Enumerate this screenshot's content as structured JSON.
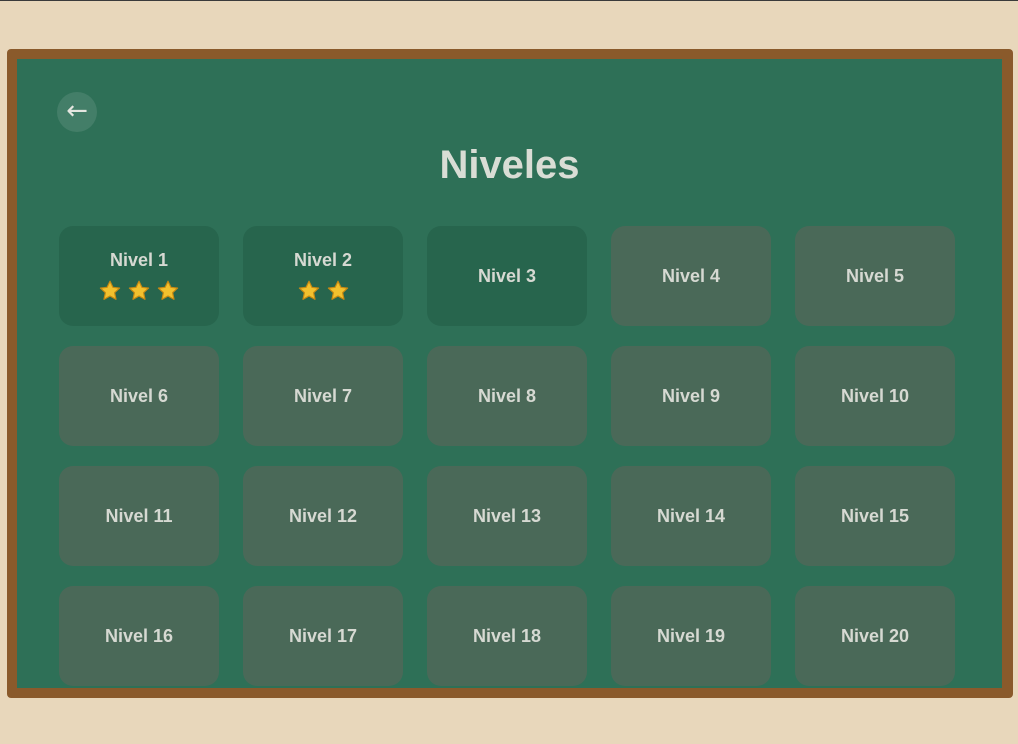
{
  "header": {
    "back_icon": "←",
    "title": "Niveles"
  },
  "colors": {
    "page_background": "#e8d7bb",
    "board_frame": "#8a5a2b",
    "board_surface": "#2e7057",
    "level_unlocked": "#27654d",
    "level_locked": "#4a6958",
    "star": "#f2c12e"
  },
  "levels": [
    {
      "label": "Nivel 1",
      "unlocked": true,
      "stars": 3
    },
    {
      "label": "Nivel 2",
      "unlocked": true,
      "stars": 2
    },
    {
      "label": "Nivel 3",
      "unlocked": true,
      "stars": 0
    },
    {
      "label": "Nivel 4",
      "unlocked": false,
      "stars": 0
    },
    {
      "label": "Nivel 5",
      "unlocked": false,
      "stars": 0
    },
    {
      "label": "Nivel 6",
      "unlocked": false,
      "stars": 0
    },
    {
      "label": "Nivel 7",
      "unlocked": false,
      "stars": 0
    },
    {
      "label": "Nivel 8",
      "unlocked": false,
      "stars": 0
    },
    {
      "label": "Nivel 9",
      "unlocked": false,
      "stars": 0
    },
    {
      "label": "Nivel 10",
      "unlocked": false,
      "stars": 0
    },
    {
      "label": "Nivel 11",
      "unlocked": false,
      "stars": 0
    },
    {
      "label": "Nivel 12",
      "unlocked": false,
      "stars": 0
    },
    {
      "label": "Nivel 13",
      "unlocked": false,
      "stars": 0
    },
    {
      "label": "Nivel 14",
      "unlocked": false,
      "stars": 0
    },
    {
      "label": "Nivel 15",
      "unlocked": false,
      "stars": 0
    },
    {
      "label": "Nivel 16",
      "unlocked": false,
      "stars": 0
    },
    {
      "label": "Nivel 17",
      "unlocked": false,
      "stars": 0
    },
    {
      "label": "Nivel 18",
      "unlocked": false,
      "stars": 0
    },
    {
      "label": "Nivel 19",
      "unlocked": false,
      "stars": 0
    },
    {
      "label": "Nivel 20",
      "unlocked": false,
      "stars": 0
    }
  ]
}
